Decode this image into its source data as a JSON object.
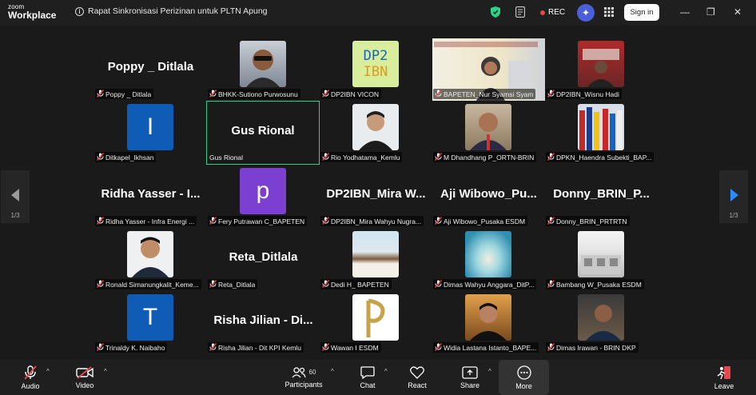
{
  "titlebar": {
    "logo_small": "zoom",
    "logo_big": "Workplace",
    "meeting_title": "Rapat Sinkronisasi Perizinan untuk PLTN Apung",
    "rec_label": "REC",
    "signin_label": "Sign in"
  },
  "grid": {
    "page_left": "1/3",
    "page_right": "1/3",
    "tiles": [
      {
        "big": "Poppy _ Ditlala",
        "label": "Poppy _ Ditlala"
      },
      {
        "big": "",
        "label": "BHKK-Sutiono Purwosunu"
      },
      {
        "big": "",
        "label": "DP2IBN VICON"
      },
      {
        "big": "",
        "label": "BAPETEN_Nur Syamsi Syam"
      },
      {
        "big": "",
        "label": "DP2IBN_Wisnu Hadi"
      },
      {
        "big": "",
        "label": "Ditkapel_Ikhsan"
      },
      {
        "big": "Gus Rional",
        "label": "Gus Rional"
      },
      {
        "big": "",
        "label": "Rio Yodhatama_Kemlu"
      },
      {
        "big": "",
        "label": "M Dhandhang P_ORTN-BRIN"
      },
      {
        "big": "",
        "label": "DPKN_Haendra Subekti_BAP..."
      },
      {
        "big": "Ridha Yasser - I...",
        "label": "Ridha Yasser - Infra Energi ..."
      },
      {
        "big": "",
        "label": "Fery Putrawan C_BAPETEN"
      },
      {
        "big": "DP2IBN_Mira W...",
        "label": "DP2IBN_Mira Wahyu Nugra..."
      },
      {
        "big": "Aji Wibowo_Pu...",
        "label": "Aji Wibowo_Pusaka ESDM"
      },
      {
        "big": "Donny_BRIN_P...",
        "label": "Donny_BRIN_PRTRTN"
      },
      {
        "big": "",
        "label": "Ronald Simanungkalit_Keme..."
      },
      {
        "big": "Reta_Ditlala",
        "label": "Reta_Ditlala"
      },
      {
        "big": "",
        "label": "Dedi H_ BAPETEN"
      },
      {
        "big": "",
        "label": "Dimas Wahyu Anggara_DitP..."
      },
      {
        "big": "",
        "label": "Bambang W_Pusaka ESDM"
      },
      {
        "big": "",
        "label": "Trinaldy K. Naibaho"
      },
      {
        "big": "Risha Jilian - Di...",
        "label": "Risha Jilian - Dit KPI Kemlu"
      },
      {
        "big": "",
        "label": "Wawan I ESDM"
      },
      {
        "big": "",
        "label": "Widia Lastana Istanto_BAPE..."
      },
      {
        "big": "",
        "label": "Dimas Irawan - BRIN DKP"
      }
    ],
    "avatars": {
      "ikhsan": "I",
      "fery": "p",
      "trinaldy": "T"
    },
    "logo_text": {
      "line1": "DP2",
      "line2": "IBN"
    }
  },
  "toolbar": {
    "audio": "Audio",
    "video": "Video",
    "participants": "Participants",
    "participants_count": "60",
    "chat": "Chat",
    "react": "React",
    "share": "Share",
    "more": "More",
    "leave": "Leave"
  },
  "colors": {
    "active_speaker": "#2bd38a",
    "rec_dot": "#e5484d",
    "avatar_blue": "#0e5cb5",
    "avatar_purple": "#7b3fd1"
  }
}
